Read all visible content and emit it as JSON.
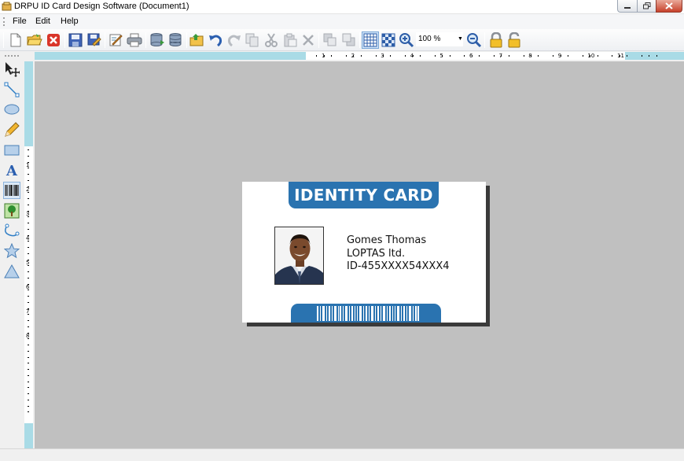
{
  "window": {
    "title": "DRPU ID Card Design Software  (Document1)"
  },
  "menu": {
    "items": [
      {
        "label": "File"
      },
      {
        "label": "Edit"
      },
      {
        "label": "Help"
      }
    ]
  },
  "toolbar": {
    "zoom_value": "100 %"
  },
  "rulers": {
    "top": [
      "1",
      "2",
      "3",
      "4",
      "5",
      "6",
      "7",
      "8",
      "9",
      "10",
      "11"
    ],
    "left": [
      "1",
      "2",
      "3",
      "4",
      "5",
      "6",
      "7",
      "8"
    ]
  },
  "card": {
    "title": "IDENTITY CARD",
    "name": "Gomes Thomas",
    "company": "LOPTAS ltd.",
    "id_number": "ID-455XXXX54XXX4",
    "accent_color": "#2a73b0"
  },
  "colors": {
    "canvas": "#c0c0c0",
    "ruler": "#a9dbe6"
  }
}
